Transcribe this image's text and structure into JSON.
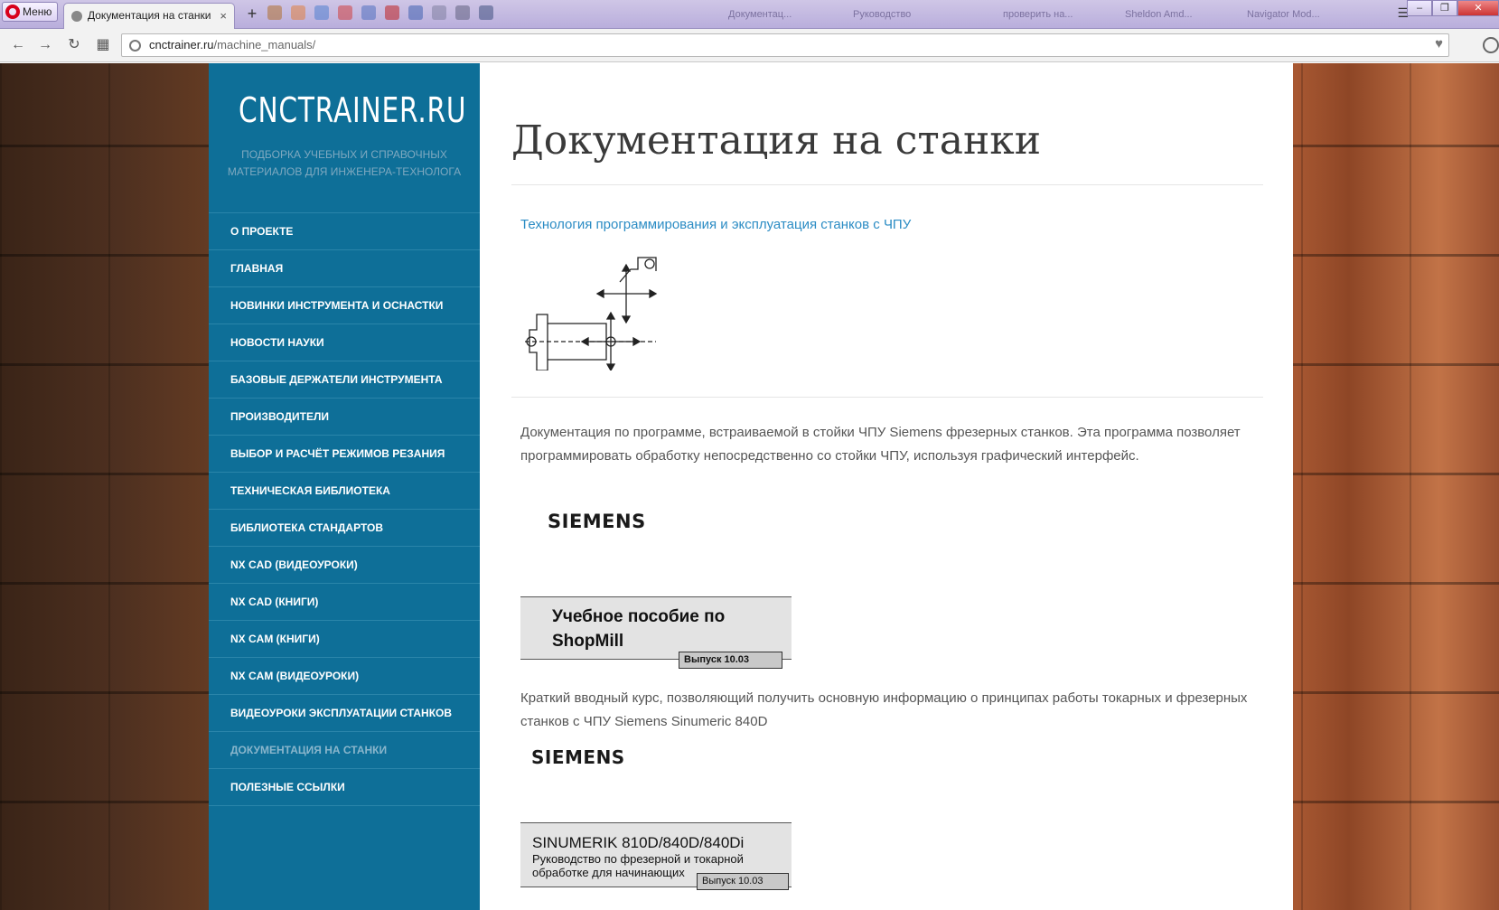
{
  "browser": {
    "menu_label": "Меню",
    "active_tab_title": "Документация на станки",
    "tab_close": "×",
    "new_tab": "+",
    "background_tabs": [
      "Документац...",
      "Руководство",
      "проверить на...",
      "Sheldon Amd...",
      "Navigator Mod..."
    ],
    "url_domain": "cnctrainer.ru",
    "url_path": "/machine_manuals/"
  },
  "site": {
    "logo": "CNCTRAINER.RU",
    "tagline": "Подборка учебных и справочных материалов для инженера-технолога"
  },
  "nav": [
    {
      "label": "О проекте"
    },
    {
      "label": "Главная"
    },
    {
      "label": "Новинки инструмента и оснастки"
    },
    {
      "label": "Новости науки"
    },
    {
      "label": "Базовые держатели инструмента"
    },
    {
      "label": "Производители"
    },
    {
      "label": "Выбор и расчёт режимов резания"
    },
    {
      "label": "Техническая библиотека"
    },
    {
      "label": "Библиотека стандартов"
    },
    {
      "label": "NX CAD (видеоуроки)"
    },
    {
      "label": "NX CAD (книги)"
    },
    {
      "label": "NX CAM (книги)"
    },
    {
      "label": "NX CAM (видеоуроки)"
    },
    {
      "label": "Видеоуроки эксплуатации станков"
    },
    {
      "label": "Документация на станки"
    },
    {
      "label": "Полезные ссылки"
    }
  ],
  "main": {
    "title": "Документация на станки",
    "link_1": "Технология программирования и эксплуатация станков с ЧПУ",
    "paragraph_1": "Документация по программе, встраиваемой в стойки ЧПУ Siemens фрезерных станков. Эта программа позволяет программировать обработку непосредственно со стойки ЧПУ, используя графический интерфейс.",
    "doc1": {
      "brand": "SIEMENS",
      "title_line1": "Учебное пособие по",
      "title_line2": "ShopMill",
      "badge": "Выпуск 10.03"
    },
    "paragraph_2": "Краткий вводный курс, позволяющий получить основную информацию о принципах работы токарных и фрезерных станков с ЧПУ Siemens Sinumeric 840D",
    "doc2": {
      "brand": "SIEMENS",
      "title": "SINUMERIK 810D/840D/840Di",
      "subtitle_line1": "Руководство по фрезерной и токарной",
      "subtitle_line2": "обработке для начинающих",
      "badge": "Выпуск 10.03"
    }
  },
  "colors": {
    "sidebar": "#0e6f98",
    "link": "#2b8cc4",
    "current_nav": "#8ab6cc"
  }
}
